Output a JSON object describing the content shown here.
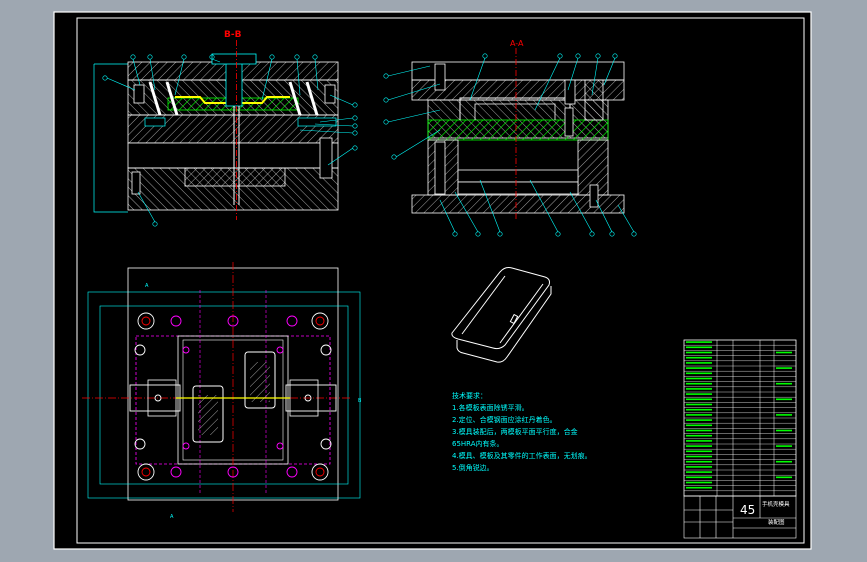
{
  "drawing": {
    "section_label_left": "B-B",
    "section_label_right": "A-A",
    "tech_req_title": "技术要求：",
    "tech_req_lines": [
      "1.各模板表面除锈平滑。",
      "2.定位、合模钢面应涂红丹着色。",
      "3.模具装配后，两模板平面平行度，合金",
      "65HRA内有条。",
      "4.模具、模板及其零件的工作表面，无划痕。",
      "5.倒角锐边。"
    ],
    "scale_number": "45",
    "title_block_name": "手机壳模具",
    "title_block_sub": "装配图",
    "dim_left": "A",
    "dim_right": "B",
    "dim_bottom": "A"
  },
  "colors": {
    "frame": "#ffffff",
    "outline": "#00ffff",
    "section": "#00ff00",
    "center": "#ff0000",
    "hidden": "#ff00ff",
    "accent": "#ffff00",
    "dim": "#0099ff"
  }
}
